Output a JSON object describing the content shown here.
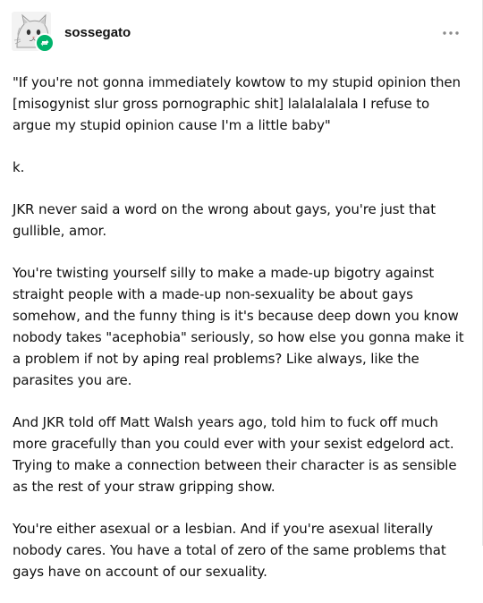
{
  "post": {
    "username": "sossegato",
    "avatar_icon": "cat-avatar",
    "badge_icon": "reblog-icon",
    "badge_color": "#00b36b",
    "more_icon": "ellipsis-icon",
    "paragraphs": [
      "\"If you're not gonna immediately kowtow to my stupid opinion then [misogynist slur gross pornographic shit] lalalalalala I refuse to argue my stupid opinion cause I'm a little baby\"",
      "k.",
      "JKR never said a word on the wrong about gays, you're just that gullible, amor.",
      "You're twisting yourself silly to make a made-up bigotry against straight people with a made-up non-sexuality be about gays somehow, and the funny thing is it's because deep down you know nobody takes \"acephobia\" seriously, so how else you gonna make it a problem if not by aping real problems? Like always, like the parasites you are.",
      "And JKR told off Matt Walsh years ago, told him to fuck off much more gracefully than you could ever with your sexist edgelord act. Trying to make a connection between their character is as sensible as the rest of your straw gripping show.",
      "You're either asexual or a lesbian. And if you're asexual literally nobody cares. You have a total of zero of the same problems that gays have on account of our sexuality."
    ]
  }
}
